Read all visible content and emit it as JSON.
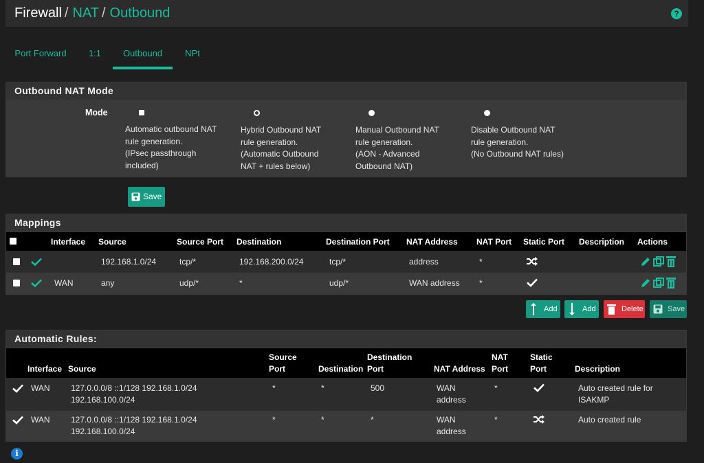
{
  "header": {
    "crumb1": "Firewall",
    "sep1": "/",
    "crumb2": "NAT",
    "sep2": "/",
    "crumb3": "Outbound",
    "help_icon": "?"
  },
  "tabs": [
    "Port Forward",
    "1:1",
    "Outbound",
    "NPt"
  ],
  "active_tab": "Outbound",
  "mode_panel": {
    "title": "Outbound NAT Mode",
    "label": "Mode",
    "options": [
      {
        "lines": [
          "Automatic outbound NAT",
          "rule generation.",
          "(IPsec passthrough",
          "included)"
        ],
        "selected": true
      },
      {
        "lines": [
          "Hybrid Outbound NAT",
          "rule generation.",
          "(Automatic Outbound",
          "NAT + rules below)"
        ],
        "selected": false
      },
      {
        "lines": [
          "Manual Outbound NAT",
          "rule generation.",
          "(AON - Advanced",
          "Outbound NAT)"
        ],
        "selected": false
      },
      {
        "lines": [
          "Disable Outbound NAT",
          "rule generation.",
          "(No Outbound NAT rules)"
        ],
        "selected": false
      }
    ],
    "save_label": "Save"
  },
  "mappings": {
    "title": "Mappings",
    "headers": [
      "Interface",
      "Source",
      "Source Port",
      "Destination",
      "Destination Port",
      "NAT Address",
      "NAT Port",
      "Static Port",
      "Description",
      "Actions"
    ],
    "rows": [
      {
        "interface": "",
        "source": "192.168.1.0/24",
        "source_port": "tcp/*",
        "destination": "192.168.200.0/24",
        "destination_port": "tcp/*",
        "nat_address": "address",
        "nat_port": "*",
        "static_port": "shuffle-icon",
        "description": ""
      },
      {
        "interface": "WAN",
        "source": "any",
        "source_port": "udp/*",
        "destination": "*",
        "destination_port": "udp/*",
        "nat_address": "WAN address",
        "nat_port": "*",
        "static_port": "check-icon",
        "description": ""
      }
    ]
  },
  "actions": {
    "add_top": "Add",
    "add_bottom": "Add",
    "delete": "Delete",
    "save": "Save"
  },
  "auto_rules": {
    "title": "Automatic Rules:",
    "headers": {
      "interface": "Interface",
      "source": "Source",
      "source_port_1": "Source",
      "source_port_2": "Port",
      "destination": "Destination",
      "destination_port_1": "Destination",
      "destination_port_2": "Port",
      "nat_address": "NAT Address",
      "nat_port_1": "NAT",
      "nat_port_2": "Port",
      "static_port_1": "Static",
      "static_port_2": "Port",
      "description": "Description"
    },
    "rows": [
      {
        "interface": "WAN",
        "source_1": "127.0.0.0/8 ::1/128 192.168.1.0/24",
        "source_2": "192.168.100.0/24",
        "source_port": "*",
        "destination": "*",
        "destination_port": "500",
        "nat_address_1": "WAN",
        "nat_address_2": "address",
        "nat_port": "*",
        "static_port": "check-icon",
        "description_1": "Auto created rule for",
        "description_2": "ISAKMP"
      },
      {
        "interface": "WAN",
        "source_1": "127.0.0.0/8 ::1/128 192.168.1.0/24",
        "source_2": "192.168.100.0/24",
        "source_port": "*",
        "destination": "*",
        "destination_port": "*",
        "nat_address_1": "WAN",
        "nat_address_2": "address",
        "nat_port": "*",
        "static_port": "shuffle-icon",
        "description_1": "Auto created rule",
        "description_2": ""
      }
    ]
  },
  "colors": {
    "accent": "#1abc9c",
    "green_button": "#179a82",
    "red_button": "#d9323a",
    "info": "#1e7ad0"
  },
  "info_icon": "i"
}
